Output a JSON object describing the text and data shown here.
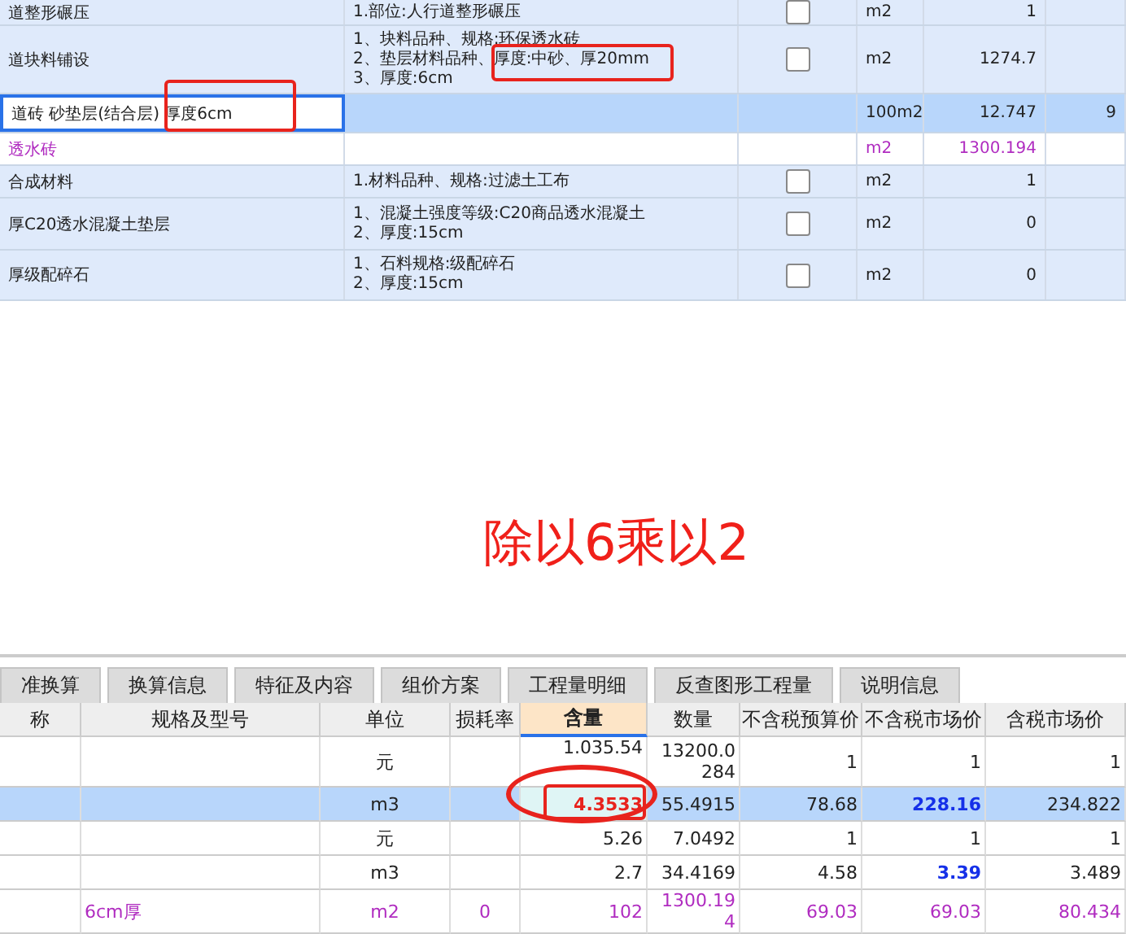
{
  "bill_table": {
    "rows": [
      {
        "kind": "bill",
        "selected": false,
        "name": "道整形碾压",
        "spec_lines": [
          "1.部位:人行道整形碾压"
        ],
        "checked": false,
        "unit": "m2",
        "quantity": "1"
      },
      {
        "kind": "bill",
        "selected": false,
        "name": "道块料铺设",
        "spec_lines": [
          "1、块料品种、规格:环保透水砖",
          "2、垫层材料品种、厚度:中砂、厚20mm",
          "3、厚度:6cm"
        ],
        "checked": false,
        "unit": "m2",
        "quantity": "1274.7"
      },
      {
        "kind": "quota",
        "selected": true,
        "name": "道砖 砂垫层(结合层) 厚度6cm",
        "unit": "100m2",
        "quantity": "12.747",
        "column_6": "9"
      },
      {
        "kind": "material",
        "selected": false,
        "name": "透水砖",
        "unit": "m2",
        "quantity": "1300.194"
      },
      {
        "kind": "bill",
        "selected": false,
        "name": "合成材料",
        "spec_lines": [
          "1.材料品种、规格:过滤土工布"
        ],
        "checked": false,
        "unit": "m2",
        "quantity": "1"
      },
      {
        "kind": "bill",
        "selected": false,
        "name": "厚C20透水混凝土垫层",
        "spec_lines": [
          "1、混凝土强度等级:C20商品透水混凝土",
          "2、厚度:15cm"
        ],
        "checked": false,
        "unit": "m2",
        "quantity": "0"
      },
      {
        "kind": "bill",
        "selected": false,
        "name": "厚级配碎石",
        "spec_lines": [
          "1、石料规格:级配碎石",
          "2、厚度:15cm"
        ],
        "checked": false,
        "unit": "m2",
        "quantity": "0"
      }
    ]
  },
  "annotation": {
    "text": "除以6乘以2"
  },
  "tabs": [
    {
      "label": "准换算",
      "selected": false
    },
    {
      "label": "换算信息",
      "selected": false
    },
    {
      "label": "特征及内容",
      "selected": false
    },
    {
      "label": "组价方案",
      "selected": false
    },
    {
      "label": "工程量明细",
      "selected": false
    },
    {
      "label": "反查图形工程量",
      "selected": false
    },
    {
      "label": "说明信息",
      "selected": false
    }
  ],
  "detail_table": {
    "columns": [
      {
        "label": "称",
        "active": false
      },
      {
        "label": "规格及型号",
        "active": false
      },
      {
        "label": "单位",
        "active": false
      },
      {
        "label": "损耗率",
        "active": false
      },
      {
        "label": "含量",
        "active": true
      },
      {
        "label": "数量",
        "active": false
      },
      {
        "label": "不含税预算价",
        "active": false
      },
      {
        "label": "不含税市场价",
        "active": false
      },
      {
        "label": "含税市场价",
        "active": false
      }
    ],
    "rows": [
      {
        "kind": "normal",
        "selected": false,
        "price_adjusted": false,
        "cells": [
          null,
          null,
          "元",
          null,
          "1.035.54",
          "13200.0284",
          "1",
          "1",
          "1"
        ]
      },
      {
        "kind": "normal",
        "selected": true,
        "price_adjusted": true,
        "cells": [
          null,
          null,
          "m3",
          null,
          "4.3533",
          "55.4915",
          "78.68",
          "228.16",
          "234.822"
        ]
      },
      {
        "kind": "normal",
        "selected": false,
        "price_adjusted": false,
        "cells": [
          null,
          null,
          "元",
          null,
          "5.26",
          "7.0492",
          "1",
          "1",
          "1"
        ]
      },
      {
        "kind": "normal",
        "selected": false,
        "price_adjusted": true,
        "cells": [
          null,
          null,
          "m3",
          null,
          "2.7",
          "34.4169",
          "4.58",
          "3.39",
          "3.489"
        ]
      },
      {
        "kind": "material",
        "selected": false,
        "price_adjusted": false,
        "cells": [
          null,
          "6cm厚",
          "m2",
          "0",
          "102",
          "1300.194",
          "69.03",
          "69.03",
          "80.434"
        ]
      }
    ]
  }
}
